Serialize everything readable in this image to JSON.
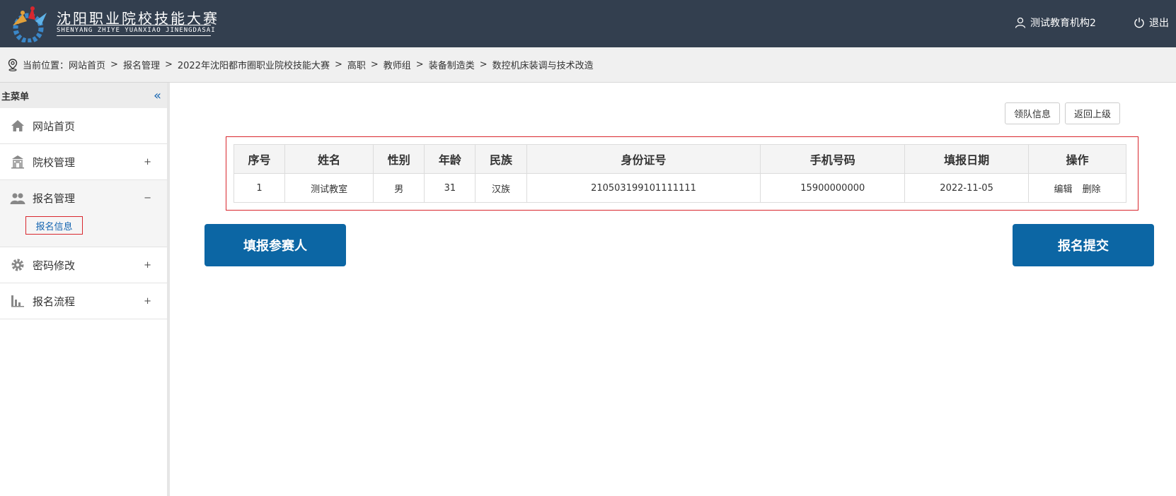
{
  "header": {
    "title": "沈阳职业院校技能大赛",
    "subtitle": "SHENYANG ZHIYE YUANXIAO JINENGDASAI",
    "user_name": "测试教育机构2",
    "logout_label": "退出"
  },
  "breadcrumb": {
    "prefix": "当前位置：",
    "items": [
      "网站首页",
      "报名管理",
      "2022年沈阳都市圈职业院校技能大赛",
      "高职",
      "教师组",
      "装备制造类",
      "数控机床装调与技术改造"
    ],
    "separator": ">"
  },
  "sidebar": {
    "header": "主菜单",
    "collapse_glyph": "«",
    "items": [
      {
        "label": "网站首页",
        "icon": "home-icon",
        "toggle": ""
      },
      {
        "label": "院校管理",
        "icon": "school-icon",
        "toggle": "+"
      },
      {
        "label": "报名管理",
        "icon": "users-icon",
        "toggle": "−"
      },
      {
        "label": "密码修改",
        "icon": "gear-icon",
        "toggle": "+"
      },
      {
        "label": "报名流程",
        "icon": "bar-chart-icon",
        "toggle": "+"
      }
    ],
    "sub_item": "报名信息"
  },
  "main": {
    "leader_button": "领队信息",
    "back_button": "返回上级",
    "table": {
      "headers": [
        "序号",
        "姓名",
        "性别",
        "年龄",
        "民族",
        "身份证号",
        "手机号码",
        "填报日期",
        "操作"
      ],
      "rows": [
        {
          "index": "1",
          "name": "测试教室",
          "gender": "男",
          "age": "31",
          "ethnicity": "汉族",
          "id_number": "210503199101111111",
          "phone": "15900000000",
          "date": "2022-11-05",
          "edit": "编辑",
          "delete": "删除"
        }
      ]
    },
    "fill_button": "填报参赛人",
    "submit_button": "报名提交"
  },
  "colors": {
    "header_bg": "#333f4f",
    "accent_blue": "#0c66a4",
    "highlight_red": "#d9272e"
  }
}
